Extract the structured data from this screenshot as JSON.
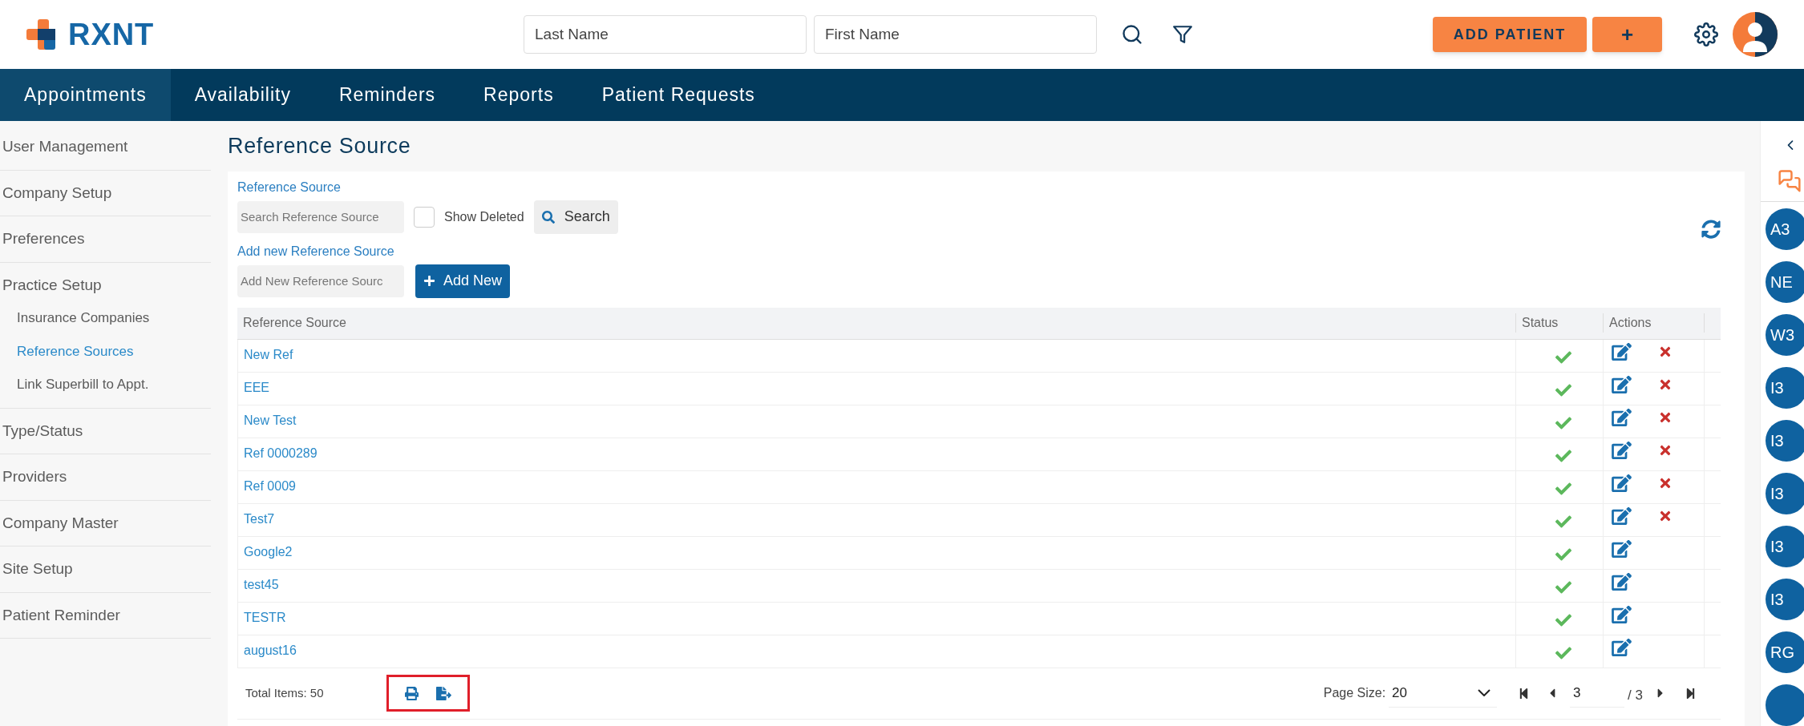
{
  "header": {
    "logo_text": "RXNT",
    "last_name": {
      "placeholder": "Last Name"
    },
    "first_name": {
      "placeholder": "First Name"
    },
    "add_patient": "ADD PATIENT",
    "add_plus": "+"
  },
  "nav": [
    {
      "label": "Appointments",
      "selected": true
    },
    {
      "label": "Availability",
      "selected": false
    },
    {
      "label": "Reminders",
      "selected": false
    },
    {
      "label": "Reports",
      "selected": false
    },
    {
      "label": "Patient Requests",
      "selected": false
    }
  ],
  "sidebar": {
    "items": [
      {
        "label": "User Management",
        "selected": false
      },
      {
        "label": "Company Setup",
        "selected": false
      },
      {
        "label": "Preferences",
        "selected": false
      },
      {
        "label": "Practice Setup",
        "selected": false,
        "children": [
          {
            "label": "Insurance Companies",
            "selected": false
          },
          {
            "label": "Reference Sources",
            "selected": true
          },
          {
            "label": "Link Superbill to Appt.",
            "selected": false
          }
        ]
      },
      {
        "label": "Type/Status",
        "selected": false
      },
      {
        "label": "Providers",
        "selected": false
      },
      {
        "label": "Company Master",
        "selected": false
      },
      {
        "label": "Site Setup",
        "selected": false
      },
      {
        "label": "Patient Reminder",
        "selected": false
      }
    ]
  },
  "page_title": "Reference Source",
  "search_form": {
    "label": "Reference Source",
    "placeholder": "Search Reference Source",
    "show_deleted": {
      "label": "Show Deleted",
      "checked": false
    },
    "search_button": "Search"
  },
  "add_form": {
    "label": "Add new Reference Source",
    "placeholder": "Add New Reference Sourc",
    "add_button": "Add New"
  },
  "table": {
    "columns": [
      "Reference Source",
      "Status",
      "Actions"
    ],
    "rows": [
      {
        "name": "New Ref",
        "active": true,
        "deletable": true
      },
      {
        "name": "EEE",
        "active": true,
        "deletable": true
      },
      {
        "name": "New Test",
        "active": true,
        "deletable": true
      },
      {
        "name": "Ref 0000289",
        "active": true,
        "deletable": true
      },
      {
        "name": "Ref 0009",
        "active": true,
        "deletable": true
      },
      {
        "name": "Test7",
        "active": true,
        "deletable": true
      },
      {
        "name": "Google2",
        "active": true,
        "deletable": false
      },
      {
        "name": "test45",
        "active": true,
        "deletable": false
      },
      {
        "name": "TESTR",
        "active": true,
        "deletable": false
      },
      {
        "name": "august16",
        "active": true,
        "deletable": false
      }
    ]
  },
  "footer": {
    "total": "Total Items: 50",
    "tools_highlighted": true,
    "page_size_label": "Page Size:",
    "page_size": "20",
    "page": "3",
    "page_count": "/ 3"
  },
  "right_rail": {
    "badges": [
      "A3",
      "NE",
      "W3",
      "I3",
      "I3",
      "I3",
      "I3",
      "I3",
      "RG"
    ]
  }
}
